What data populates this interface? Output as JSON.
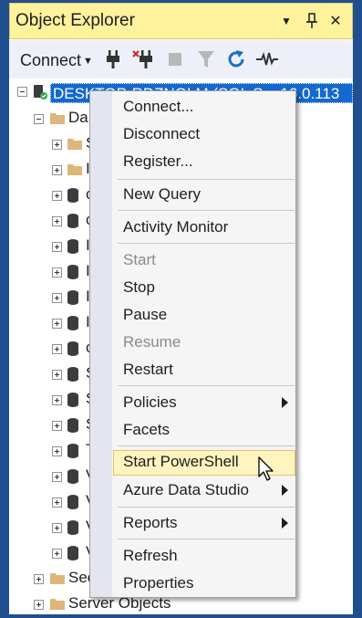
{
  "panel": {
    "title": "Object Explorer",
    "pin_glyph": "⊥",
    "dropdown_glyph": "▼",
    "close_glyph": "✕"
  },
  "toolbar": {
    "connect_label": "Connect",
    "icons": [
      "connect-plug-icon",
      "disconnect-plug-icon",
      "stop-icon",
      "filter-icon",
      "refresh-icon",
      "activity-monitor-icon"
    ]
  },
  "tree": {
    "server_label": "DESKTOP-RDZNOLM (SQL S...   16.0.113",
    "databases_label": "Da",
    "child_fragments": [
      "S",
      "I",
      "c",
      "c",
      "I",
      "I",
      "I",
      "I",
      "c",
      "S",
      "S",
      "S",
      "T",
      "V",
      "V",
      "V",
      "V"
    ],
    "security_label": "Sec",
    "server_objects_label": "Server Objects"
  },
  "context_menu": {
    "items": [
      {
        "label": "Connect...",
        "enabled": true,
        "submenu": false
      },
      {
        "label": "Disconnect",
        "enabled": true,
        "submenu": false
      },
      {
        "label": "Register...",
        "enabled": true,
        "submenu": false
      },
      {
        "label": "New Query",
        "enabled": true,
        "submenu": false
      },
      {
        "label": "Activity Monitor",
        "enabled": true,
        "submenu": false
      },
      {
        "label": "Start",
        "enabled": false,
        "submenu": false
      },
      {
        "label": "Stop",
        "enabled": true,
        "submenu": false
      },
      {
        "label": "Pause",
        "enabled": true,
        "submenu": false
      },
      {
        "label": "Resume",
        "enabled": false,
        "submenu": false
      },
      {
        "label": "Restart",
        "enabled": true,
        "submenu": false
      },
      {
        "label": "Policies",
        "enabled": true,
        "submenu": true
      },
      {
        "label": "Facets",
        "enabled": true,
        "submenu": false
      },
      {
        "label": "Start PowerShell",
        "enabled": true,
        "submenu": false,
        "highlighted": true
      },
      {
        "label": "Azure Data Studio",
        "enabled": true,
        "submenu": true
      },
      {
        "label": "Reports",
        "enabled": true,
        "submenu": true
      },
      {
        "label": "Refresh",
        "enabled": true,
        "submenu": false
      },
      {
        "label": "Properties",
        "enabled": true,
        "submenu": false
      }
    ]
  },
  "colors": {
    "frame": "#1f4f8f",
    "title_bg": "#fff29d",
    "selection": "#1468d0",
    "menu_hover": "#fdf4bf",
    "refresh_icon": "#1a6fc4"
  }
}
